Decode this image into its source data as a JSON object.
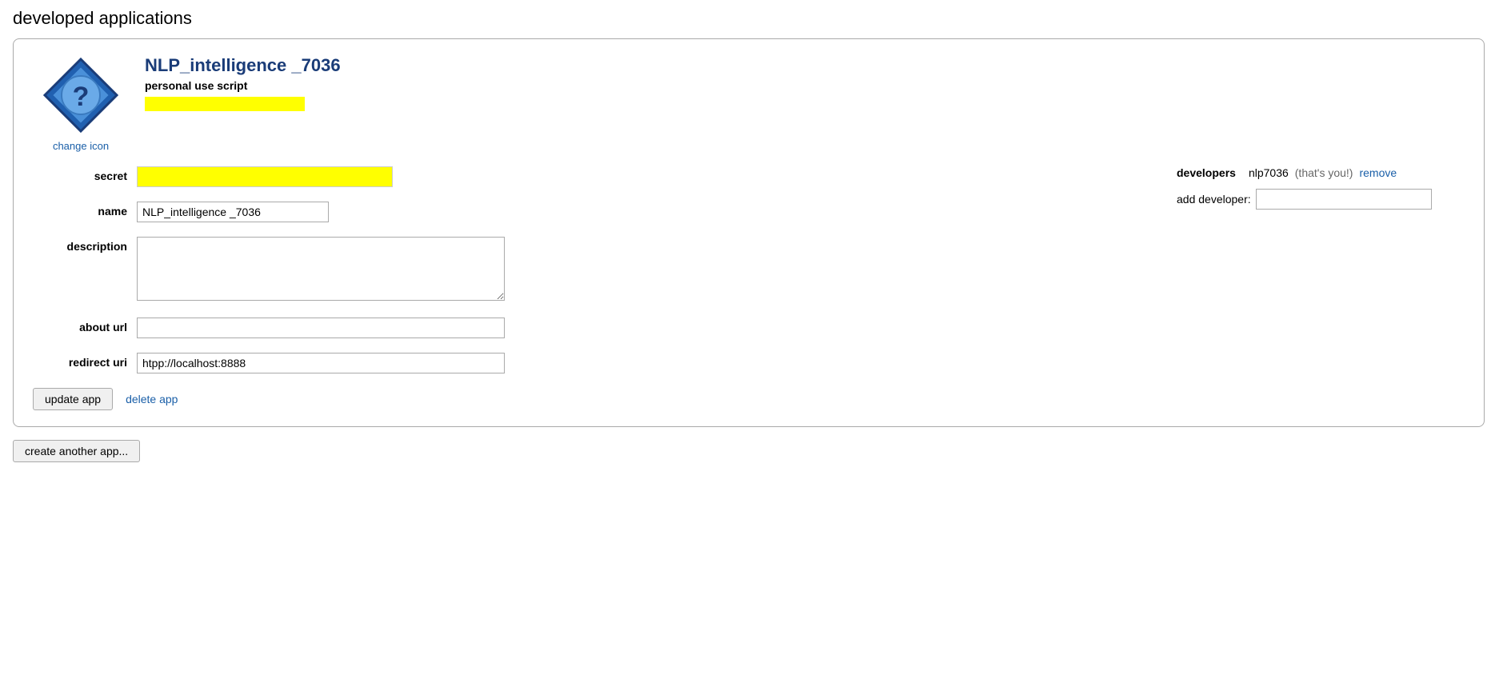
{
  "page": {
    "title": "developed applications"
  },
  "app": {
    "name": "NLP_intelligence _7036",
    "type": "personal use script",
    "change_icon_label": "change icon",
    "secret_label": "secret",
    "name_label": "name",
    "name_value": "NLP_intelligence _7036",
    "description_label": "description",
    "description_value": "",
    "about_url_label": "about url",
    "about_url_value": "",
    "redirect_uri_label": "redirect uri",
    "redirect_uri_value": "htpp://localhost:8888",
    "update_button_label": "update app",
    "delete_link_label": "delete app"
  },
  "developers": {
    "label": "developers",
    "dev_name": "nlp7036",
    "dev_you": "(that's you!)",
    "dev_remove": "remove",
    "add_label": "add developer:",
    "add_placeholder": ""
  },
  "footer": {
    "create_another_label": "create another app..."
  },
  "icon": {
    "name": "question-mark-diamond-icon"
  }
}
